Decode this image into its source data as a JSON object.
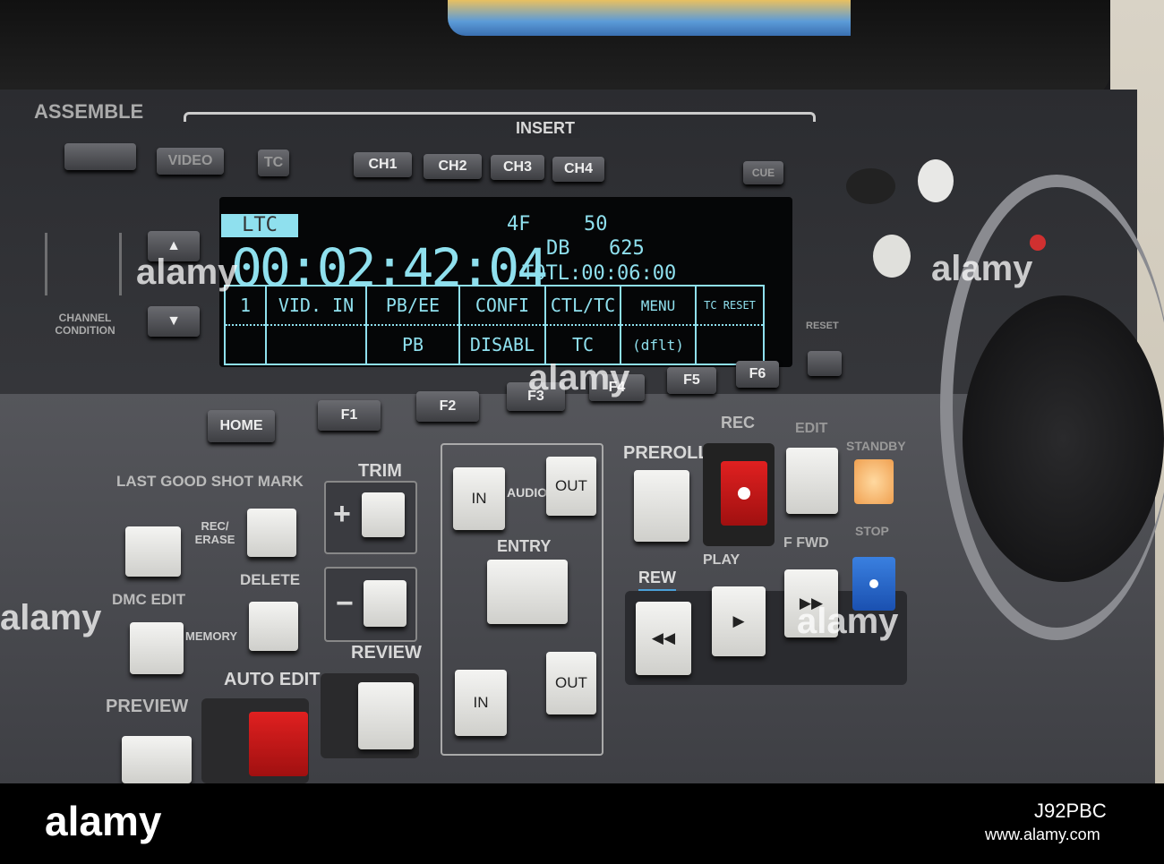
{
  "panel": {
    "assemble": "ASSEMBLE",
    "insert": "INSERT",
    "video": "VIDEO",
    "tc": "TC",
    "ch1": "CH1",
    "ch2": "CH2",
    "ch3": "CH3",
    "ch4": "CH4",
    "cue": "CUE",
    "channel_condition": "CHANNEL CONDITION",
    "home": "HOME",
    "f1": "F1",
    "f2": "F2",
    "f3": "F3",
    "f4": "F4",
    "f5": "F5",
    "f6": "F6",
    "reset": "RESET",
    "trim": "TRIM",
    "plus": "+",
    "minus": "−",
    "audio": "AUDIO",
    "in": "IN",
    "out": "OUT",
    "entry": "ENTRY",
    "preroll": "PREROLL",
    "rec": "REC",
    "edit": "EDIT",
    "standby": "STANDBY",
    "rew": "REW",
    "play": "PLAY",
    "ffwd": "F FWD",
    "stop": "STOP",
    "last_good_shot_mark": "LAST GOOD SHOT MARK",
    "rec_erase": "REC/ ERASE",
    "dmc_edit": "DMC EDIT",
    "delete": "DELETE",
    "memory": "MEMORY",
    "preview": "PREVIEW",
    "auto_edit": "AUTO EDIT",
    "review": "REVIEW"
  },
  "display": {
    "ltc": "LTC",
    "timecode": "00:02:42:04",
    "fr": "4F",
    "hz": "50",
    "db": "DB",
    "lines": "625",
    "total": "TOTL:00:06:00",
    "menu": [
      {
        "top": "1",
        "bottom": ""
      },
      {
        "top": "VID. IN",
        "bottom": ""
      },
      {
        "top": "PB/EE",
        "bottom": "PB"
      },
      {
        "top": "CONFI",
        "bottom": "DISABL"
      },
      {
        "top": "CTL/TC",
        "bottom": "TC"
      },
      {
        "top": "MENU",
        "bottom": "(dflt)"
      },
      {
        "top": "TC RESET",
        "bottom": ""
      }
    ]
  },
  "watermark": {
    "brand": "alamy",
    "image_id": "J92PBC",
    "url": "www.alamy.com"
  }
}
